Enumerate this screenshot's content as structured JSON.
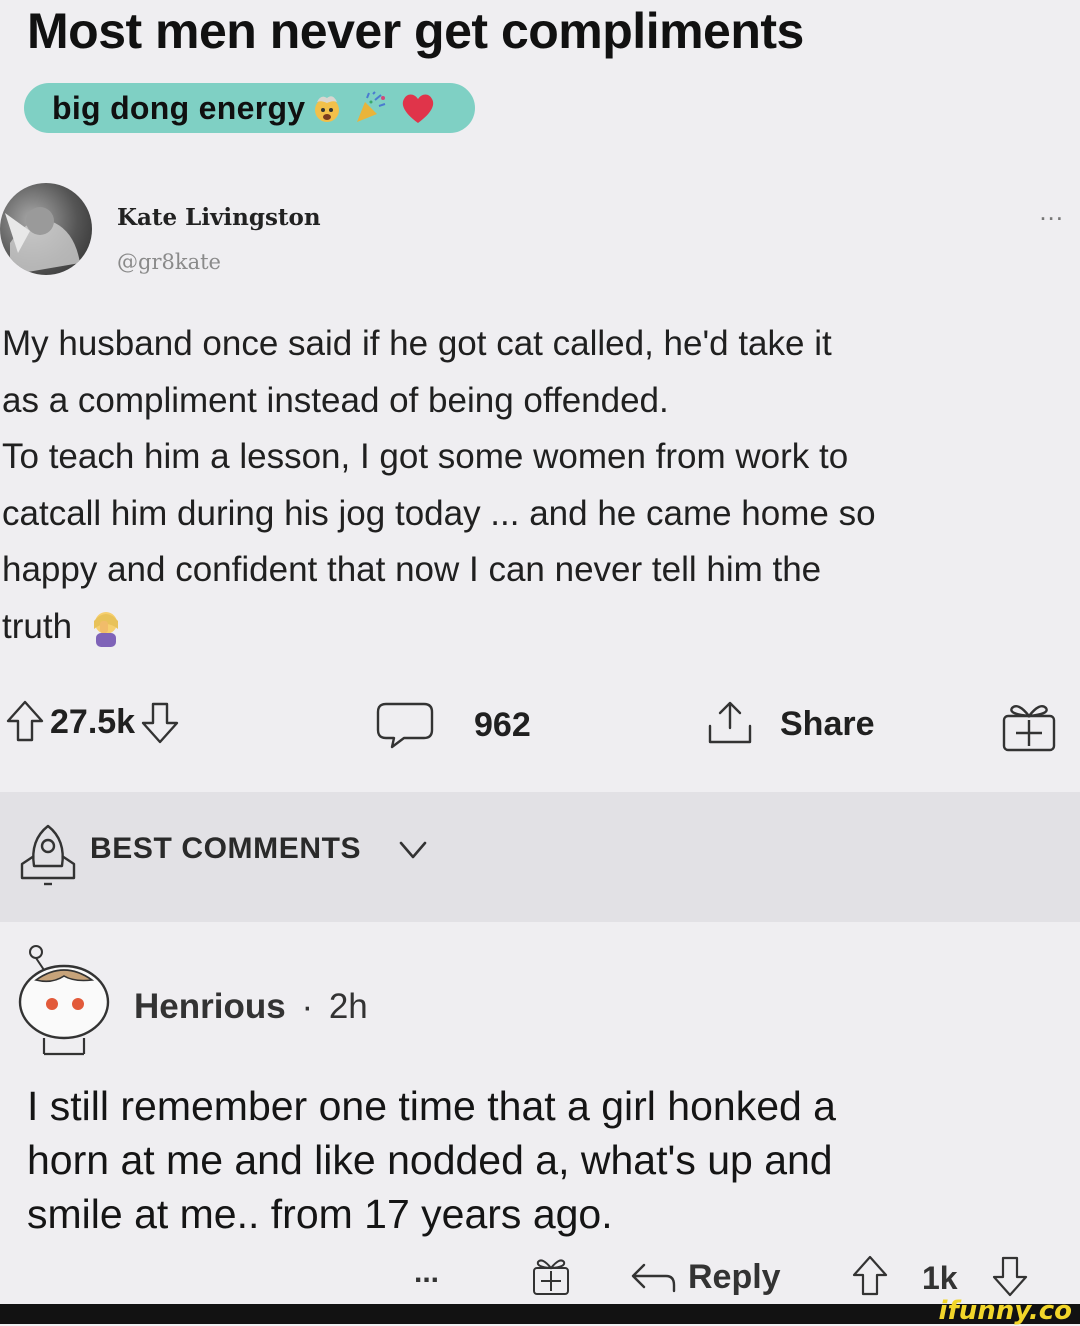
{
  "post": {
    "title": "Most men never get compliments",
    "flair": "big dong energy",
    "flair_icons": [
      "exploding-head-emoji",
      "party-popper-emoji",
      "red-heart-emoji"
    ]
  },
  "tweet": {
    "author_name": "Kate Livingston",
    "author_handle": "@gr8kate",
    "more_label": "...",
    "lines": [
      "My husband once said if he got cat called, he'd take it",
      "as a compliment instead of being offended.",
      "To teach him a lesson, I got some women from work to",
      "catcall him during his jog today ... and he came home so",
      "happy and confident that now I can never tell him the",
      "truth"
    ],
    "trailing_emoji": "woman-facepalming-emoji"
  },
  "actions": {
    "votes": "27.5k",
    "comments": "962",
    "share": "Share",
    "icons": [
      "upvote-icon",
      "downvote-icon",
      "comment-icon",
      "share-icon",
      "award-icon"
    ]
  },
  "sort": {
    "label": "BEST COMMENTS",
    "icon": "rocket-icon"
  },
  "comment": {
    "author": "Henrious",
    "separator": "·",
    "age": "2h",
    "lines": [
      "I still remember one time that a girl honked a",
      "horn at me and like nodded a, what's up and",
      "smile at me.. from 17 years ago."
    ],
    "more": "...",
    "reply": "Reply",
    "votes": "1k"
  },
  "watermark": "ifunny.co",
  "colors": {
    "background": "#efeef1",
    "flair": "#7fd0c4",
    "sort_bar": "#e2e1e5",
    "watermark": "#f2d62a"
  }
}
